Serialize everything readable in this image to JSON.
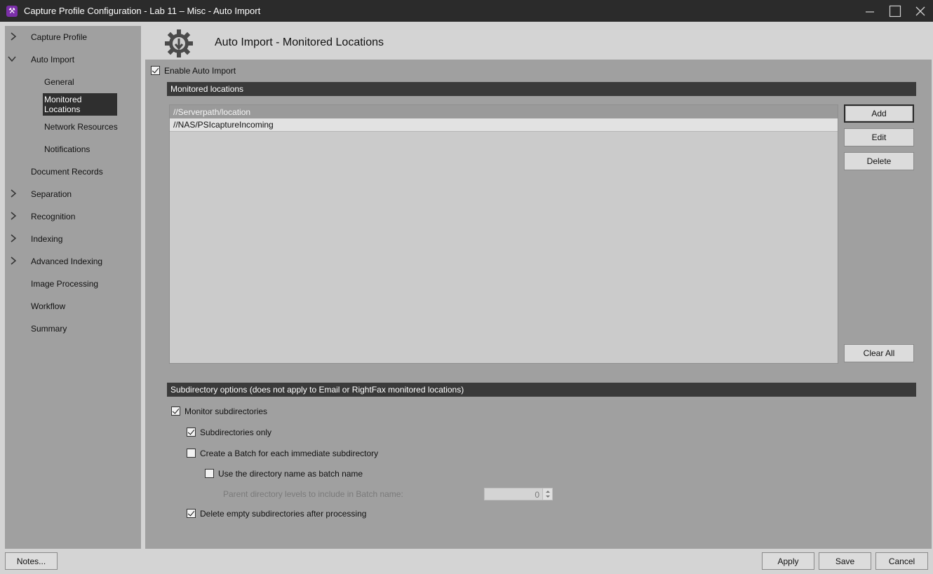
{
  "window": {
    "title": "Capture Profile Configuration - Lab 11 – Misc - Auto Import",
    "app_icon_glyph": "⚒",
    "controls": [
      "minimize-icon",
      "maximize-icon",
      "close-icon"
    ]
  },
  "sidebar": {
    "items": [
      {
        "label": "Capture Profile",
        "expander": "collapsed"
      },
      {
        "label": "Auto Import",
        "expander": "expanded"
      },
      {
        "label": "General",
        "level": 2
      },
      {
        "label": "Monitored Locations",
        "level": 2,
        "selected": true
      },
      {
        "label": "Network Resources",
        "level": 2
      },
      {
        "label": "Notifications",
        "level": 2
      },
      {
        "label": "Document Records"
      },
      {
        "label": "Separation",
        "expander": "collapsed"
      },
      {
        "label": "Recognition",
        "expander": "collapsed"
      },
      {
        "label": "Indexing",
        "expander": "collapsed"
      },
      {
        "label": "Advanced Indexing",
        "expander": "collapsed"
      },
      {
        "label": "Image Processing"
      },
      {
        "label": "Workflow"
      },
      {
        "label": "Summary"
      }
    ]
  },
  "main": {
    "header_title": "Auto Import - Monitored Locations",
    "header_icon": "gear-download-icon",
    "enable_auto_import": {
      "label": "Enable Auto Import",
      "checked": true
    },
    "monitored_locations": {
      "section_title": "Monitored locations",
      "items": [
        "//Serverpath/location",
        "//NAS/PSIcaptureIncoming"
      ],
      "selected_index": 0,
      "buttons": {
        "add": "Add",
        "edit": "Edit",
        "delete": "Delete",
        "clear_all": "Clear All"
      }
    },
    "subdirectory_options": {
      "section_title": "Subdirectory options (does not apply to Email or RightFax monitored locations)",
      "monitor_subdirectories": {
        "label": "Monitor subdirectories",
        "checked": true
      },
      "subdirectories_only": {
        "label": "Subdirectories only",
        "checked": true
      },
      "batch_per_subdirectory": {
        "label": "Create a Batch for each immediate subdirectory",
        "checked": false
      },
      "use_directory_name": {
        "label": "Use the directory name as batch name",
        "checked": false
      },
      "parent_levels": {
        "label": "Parent directory levels to include in Batch name:",
        "value": "0",
        "enabled": false
      },
      "delete_empty": {
        "label": "Delete empty subdirectories after processing",
        "checked": true
      }
    }
  },
  "footer": {
    "notes": "Notes...",
    "apply": "Apply",
    "save": "Save",
    "cancel": "Cancel"
  }
}
